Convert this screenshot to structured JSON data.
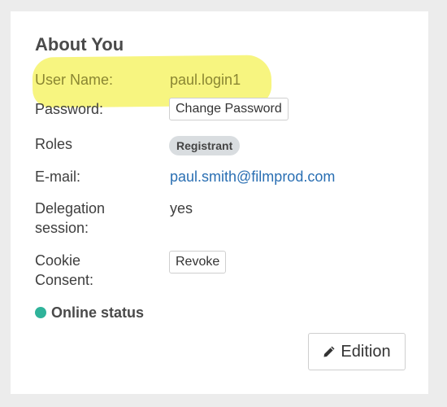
{
  "section": {
    "title": "About You"
  },
  "user_name": {
    "label": "User Name:",
    "value": "paul.login1"
  },
  "password": {
    "label": "Password:",
    "button_label": "Change Password"
  },
  "roles": {
    "label": "Roles",
    "badge": "Registrant"
  },
  "email": {
    "label": "E-mail:",
    "value": "paul.smith@filmprod.com"
  },
  "delegation": {
    "label_line1": "Delegation",
    "label_line2": "session:",
    "value": "yes"
  },
  "cookie": {
    "label_line1": "Cookie",
    "label_line2": "Consent:",
    "button_label": "Revoke"
  },
  "status": {
    "label": "Online status",
    "color": "#2fb39a"
  },
  "edition": {
    "button_label": "Edition",
    "icon": "pencil-icon"
  },
  "highlight_color": "#f6f36a"
}
